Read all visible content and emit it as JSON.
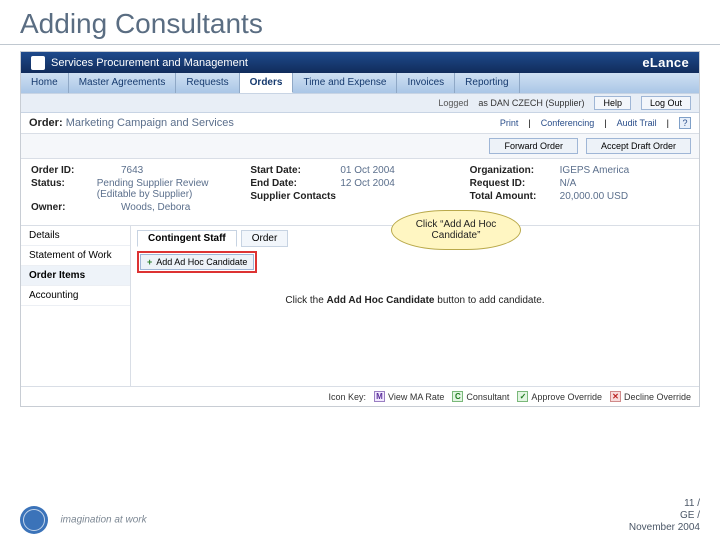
{
  "slide_title": "Adding Consultants",
  "titlebar": {
    "app_name": "Services Procurement and Management",
    "brand": "eLance"
  },
  "nav": {
    "home": "Home",
    "master": "Master Agreements",
    "requests": "Requests",
    "orders": "Orders",
    "time": "Time and Expense",
    "invoices": "Invoices",
    "reporting": "Reporting"
  },
  "userbar": {
    "logged_lbl": "Logged",
    "logged_as": "as DAN CZECH (Supplier)",
    "help": "Help",
    "logout": "Log Out"
  },
  "orderrow": {
    "label": "Order:",
    "name": "Marketing Campaign and Services",
    "print": "Print",
    "conferencing": "Conferencing",
    "audit": "Audit Trail",
    "help_glyph": "?"
  },
  "actionbar": {
    "forward": "Forward Order",
    "accept": "Accept Draft Order"
  },
  "meta": {
    "c1": {
      "order_id_k": "Order ID:",
      "order_id_v": "7643",
      "status_k": "Status:",
      "status_v": "Pending Supplier Review (Editable by Supplier)",
      "owner_k": "Owner:",
      "owner_v": "Woods, Debora"
    },
    "c2": {
      "start_k": "Start Date:",
      "start_v": "01 Oct 2004",
      "end_k": "End Date:",
      "end_v": "12 Oct 2004",
      "contacts_k": "Supplier Contacts"
    },
    "c3": {
      "org_k": "Organization:",
      "org_v": "IGEPS America",
      "req_k": "Request ID:",
      "req_v": "N/A",
      "total_k": "Total Amount:",
      "total_v": "20,000.00 USD"
    }
  },
  "sidemenu": {
    "details": "Details",
    "sow": "Statement of Work",
    "order_items": "Order Items",
    "accounting": "Accounting"
  },
  "subtabs": {
    "contingent": "Contingent Staff",
    "order": "Order"
  },
  "addbtn": "Add Ad Hoc Candidate",
  "hint_pre": "Click the ",
  "hint_bold": "Add Ad Hoc Candidate",
  "hint_post": " button to add candidate.",
  "callout": "Click “Add Ad Hoc Candidate”",
  "iconkey": {
    "label": "Icon Key:",
    "m": "View MA Rate",
    "c": "Consultant",
    "a": "Approve Override",
    "x": "Decline Override"
  },
  "footer": {
    "tagline": "imagination at work",
    "page": "11 /",
    "ge": "GE /",
    "date": "November 2004"
  }
}
